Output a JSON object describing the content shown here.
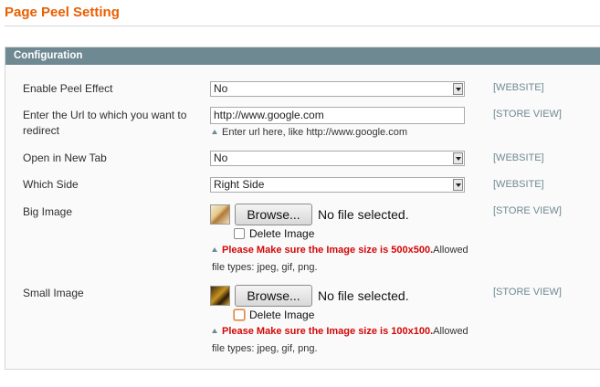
{
  "page": {
    "title": "Page Peel Setting"
  },
  "fieldset": {
    "header": "Configuration"
  },
  "fields": {
    "enable": {
      "label": "Enable Peel Effect",
      "value": "No",
      "scope": "[WEBSITE]"
    },
    "url": {
      "label_line1": "Enter the Url to which you want to",
      "label_line2": "redirect",
      "value": "http://www.google.com",
      "note": "Enter url here, like http://www.google.com",
      "scope": "[STORE VIEW]"
    },
    "new_tab": {
      "label": "Open in New Tab",
      "value": "No",
      "scope": "[WEBSITE]"
    },
    "side": {
      "label": "Which Side",
      "value": "Right Side",
      "scope": "[WEBSITE]"
    },
    "big_image": {
      "label": "Big Image",
      "browse": "Browse...",
      "no_file": "No file selected.",
      "delete_label": "Delete Image",
      "note_warn": "Please Make sure the Image size is 500x500.",
      "note_rest": "Allowed",
      "note_line2": "file types: jpeg, gif, png.",
      "scope": "[STORE VIEW]"
    },
    "small_image": {
      "label": "Small Image",
      "browse": "Browse...",
      "no_file": "No file selected.",
      "delete_label": "Delete Image",
      "note_warn": "Please Make sure the Image size is 100x100.",
      "note_rest": "Allowed",
      "note_line2": "file types: jpeg, gif, png.",
      "scope": "[STORE VIEW]"
    }
  },
  "colors": {
    "title": "#eb5e00",
    "header_bg": "#6f8992",
    "warning": "#d40707",
    "scope": "#6f8992"
  }
}
